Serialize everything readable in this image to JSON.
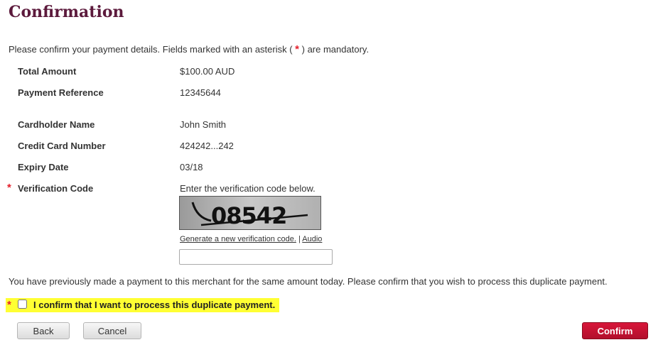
{
  "colors": {
    "title": "#5c1a3c",
    "required_star": "#e4202c",
    "confirm_button": "#c4122f",
    "highlight": "#ffff33"
  },
  "page": {
    "title": "Confirmation",
    "intro_before": "Please confirm your payment details. Fields marked with an asterisk (",
    "intro_star": "*",
    "intro_after": ") are mandatory."
  },
  "details": {
    "total_amount_label": "Total Amount",
    "total_amount_value": "$100.00 AUD",
    "payment_reference_label": "Payment Reference",
    "payment_reference_value": "12345644",
    "cardholder_name_label": "Cardholder Name",
    "cardholder_name_value": "John Smith",
    "card_number_label": "Credit Card Number",
    "card_number_value": "424242...242",
    "expiry_label": "Expiry Date",
    "expiry_value": "03/18"
  },
  "verification": {
    "star": "*",
    "label": "Verification Code",
    "instruction": "Enter the verification code below.",
    "captcha_text": "08542",
    "generate_link": "Generate a new verification code.",
    "separator": "|",
    "audio_link": "Audio",
    "input_value": ""
  },
  "duplicate": {
    "notice": "You have previously made a payment to this merchant for the same amount today. Please confirm that you wish to process this duplicate payment.",
    "star": "*",
    "checkbox_label": "I confirm that I want to process this duplicate payment.",
    "checked": false
  },
  "buttons": {
    "back": "Back",
    "cancel": "Cancel",
    "confirm": "Confirm"
  }
}
